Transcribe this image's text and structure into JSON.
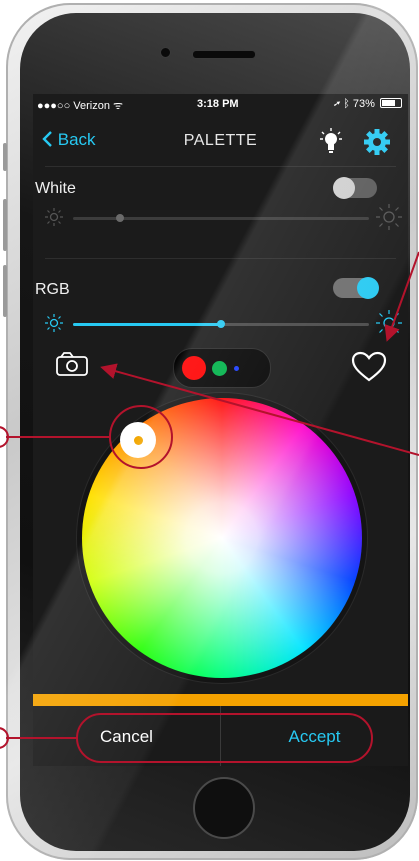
{
  "status_bar": {
    "carrier": "●●●○○ Verizon ᯤ",
    "time": "3:18 PM",
    "battery": "73%"
  },
  "nav": {
    "back_label": "Back",
    "title": "PALETTE"
  },
  "white": {
    "label": "White",
    "toggle_on": false,
    "brightness": 0.16
  },
  "rgb": {
    "label": "RGB",
    "toggle_on": true,
    "brightness": 0.5
  },
  "presets": {
    "colors": [
      "#ff0000",
      "#00b24a",
      "#1a3cff"
    ]
  },
  "actions": {
    "cancel_label": "Cancel",
    "accept_label": "Accept"
  },
  "colors": {
    "accent": "#27c9f2",
    "bar": "#f4a200",
    "annotation": "#b3132c",
    "knob_color": "#f2a600"
  },
  "icons": [
    "chevron-left-icon",
    "bulb-icon",
    "gear-icon",
    "sun-icon",
    "camera-icon",
    "heart-icon"
  ]
}
